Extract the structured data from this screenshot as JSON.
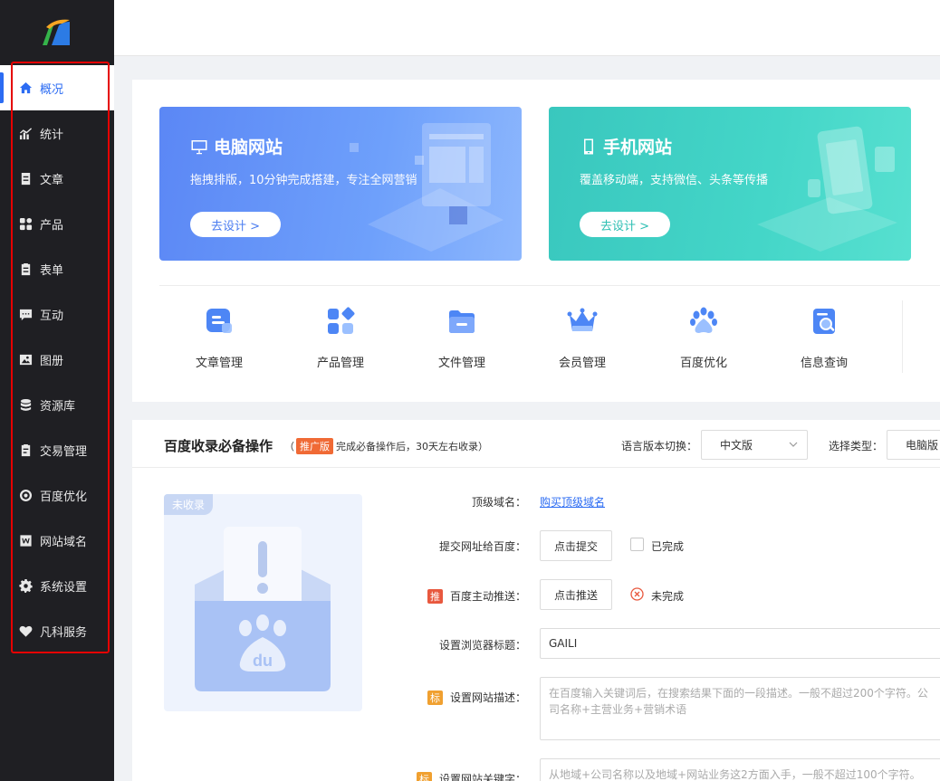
{
  "sidebar": {
    "items": [
      {
        "label": "概况",
        "icon": "home-icon"
      },
      {
        "label": "统计",
        "icon": "chart-icon"
      },
      {
        "label": "文章",
        "icon": "document-icon"
      },
      {
        "label": "产品",
        "icon": "grid-icon"
      },
      {
        "label": "表单",
        "icon": "clipboard-icon"
      },
      {
        "label": "互动",
        "icon": "chat-icon"
      },
      {
        "label": "图册",
        "icon": "image-icon"
      },
      {
        "label": "资源库",
        "icon": "database-icon"
      },
      {
        "label": "交易管理",
        "icon": "order-icon"
      },
      {
        "label": "百度优化",
        "icon": "target-icon"
      },
      {
        "label": "网站域名",
        "icon": "w-icon"
      },
      {
        "label": "系统设置",
        "icon": "gear-icon"
      },
      {
        "label": "凡科服务",
        "icon": "heart-icon"
      }
    ]
  },
  "banners": {
    "pc": {
      "title": "电脑网站",
      "desc": "拖拽排版，10分钟完成搭建，专注全网营销",
      "button": "去设计 >"
    },
    "mobile": {
      "title": "手机网站",
      "desc": "覆盖移动端，支持微信、头条等传播",
      "button": "去设计 >"
    }
  },
  "quick_links": [
    {
      "label": "文章管理",
      "icon": "article-icon"
    },
    {
      "label": "产品管理",
      "icon": "product-icon"
    },
    {
      "label": "文件管理",
      "icon": "folder-icon"
    },
    {
      "label": "会员管理",
      "icon": "crown-icon"
    },
    {
      "label": "百度优化",
      "icon": "baidu-paw-icon"
    },
    {
      "label": "信息查询",
      "icon": "search-doc-icon"
    }
  ],
  "seo": {
    "title": "百度收录必备操作",
    "sub_prefix": "（",
    "tag": "推广版",
    "sub_text": "完成必备操作后，30天左右收录",
    "sub_suffix": "）",
    "lang_label": "语言版本切换：",
    "lang_value": "中文版",
    "type_label": "选择类型：",
    "type_value": "电脑版",
    "badge": "未收录",
    "rows": {
      "domain": {
        "label": "顶级域名：",
        "link": "购买顶级域名"
      },
      "submit": {
        "label": "提交网址给百度：",
        "button": "点击提交",
        "status": "已完成"
      },
      "push": {
        "mark": "推",
        "label": "百度主动推送：",
        "button": "点击推送",
        "status": "未完成"
      },
      "title": {
        "label": "设置浏览器标题：",
        "value": "GAILI"
      },
      "desc": {
        "mark": "标",
        "label": "设置网站描述：",
        "placeholder": "在百度输入关键词后，在搜索结果下面的一段描述。一般不超过200个字符。公司名称+主营业务+营销术语"
      },
      "keywords": {
        "mark": "标",
        "label": "设置网站关键字：",
        "placeholder": "从地域+公司名称以及地域+网站业务这2方面入手，一般不超过100个字符。"
      }
    }
  },
  "colors": {
    "accent": "#2c6cf3",
    "sidebar_bg": "#1f1f23",
    "highlight_frame": "#e60000"
  }
}
